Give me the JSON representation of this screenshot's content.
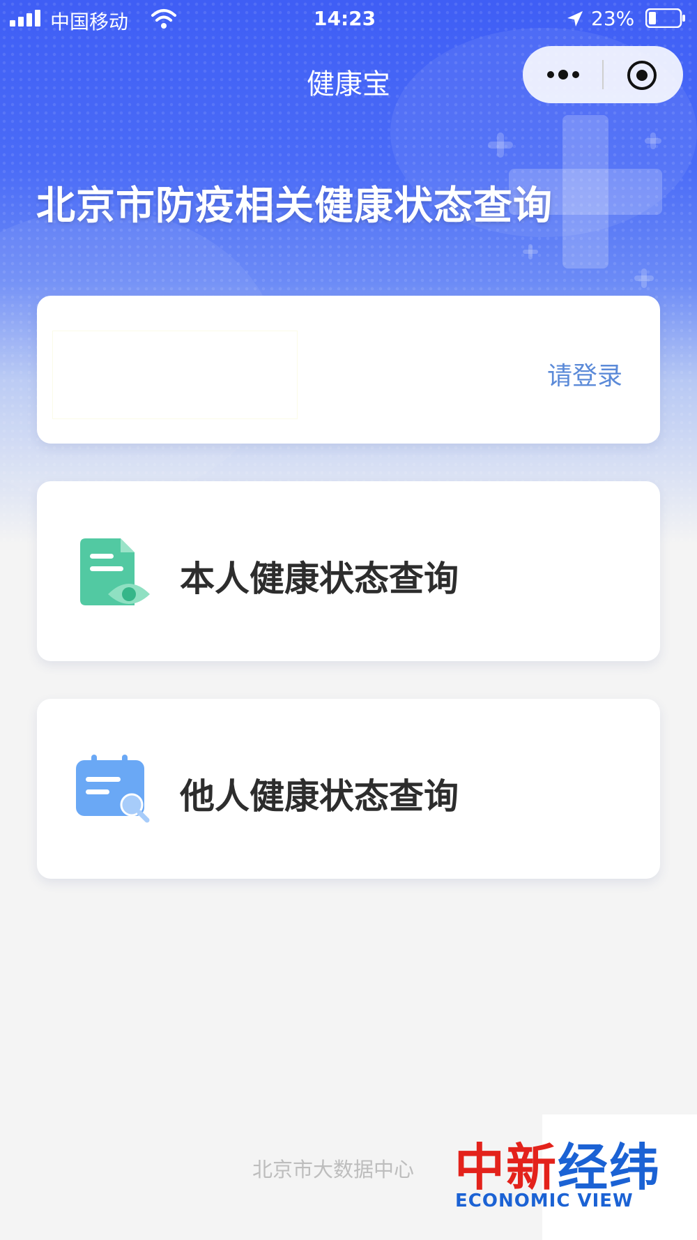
{
  "status_bar": {
    "carrier": "中国移动",
    "time": "14:23",
    "battery": "23%"
  },
  "nav": {
    "title": "健康宝",
    "more_label": "•••"
  },
  "headline": "北京市防疫相关健康状态查询",
  "login_card": {
    "login_link": "请登录"
  },
  "menu": [
    {
      "label": "本人健康状态查询",
      "icon": "document-eye-icon"
    },
    {
      "label": "他人健康状态查询",
      "icon": "calendar-search-icon"
    }
  ],
  "footer": "北京市大数据中心",
  "watermark": {
    "cn_part1": "中新",
    "cn_part2": "经纬",
    "en": "ECONOMIC VIEW"
  },
  "colors": {
    "primary": "#4766f5",
    "link": "#5b8ad8",
    "icon_green": "#4ccda3",
    "icon_blue": "#6aa7f5",
    "watermark_red": "#e3221b",
    "watermark_blue": "#1b62d4"
  }
}
